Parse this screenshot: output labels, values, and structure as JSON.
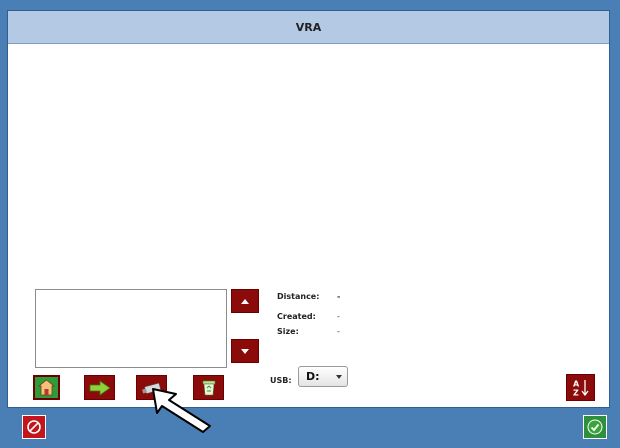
{
  "window": {
    "title": "VRA"
  },
  "details": {
    "distance_label": "Distance:",
    "distance_value": "-",
    "created_label": "Created:",
    "created_value": "-",
    "size_label": "Size:",
    "size_value": "-"
  },
  "usb": {
    "label": "USB:",
    "selected": "D:"
  },
  "toolbar": {
    "icons": [
      "home-icon",
      "forward-arrow-icon",
      "usb-drive-icon",
      "recycle-bin-icon",
      "sort-az-icon"
    ]
  },
  "footer": {
    "icons": [
      "cancel-icon",
      "ok-icon"
    ]
  },
  "colors": {
    "background": "#4a7fb5",
    "titlebar": "#b4c9e4",
    "button_red": "#8b0a0a",
    "ok_green": "#3aa53a",
    "cancel_red": "#c0161c"
  }
}
